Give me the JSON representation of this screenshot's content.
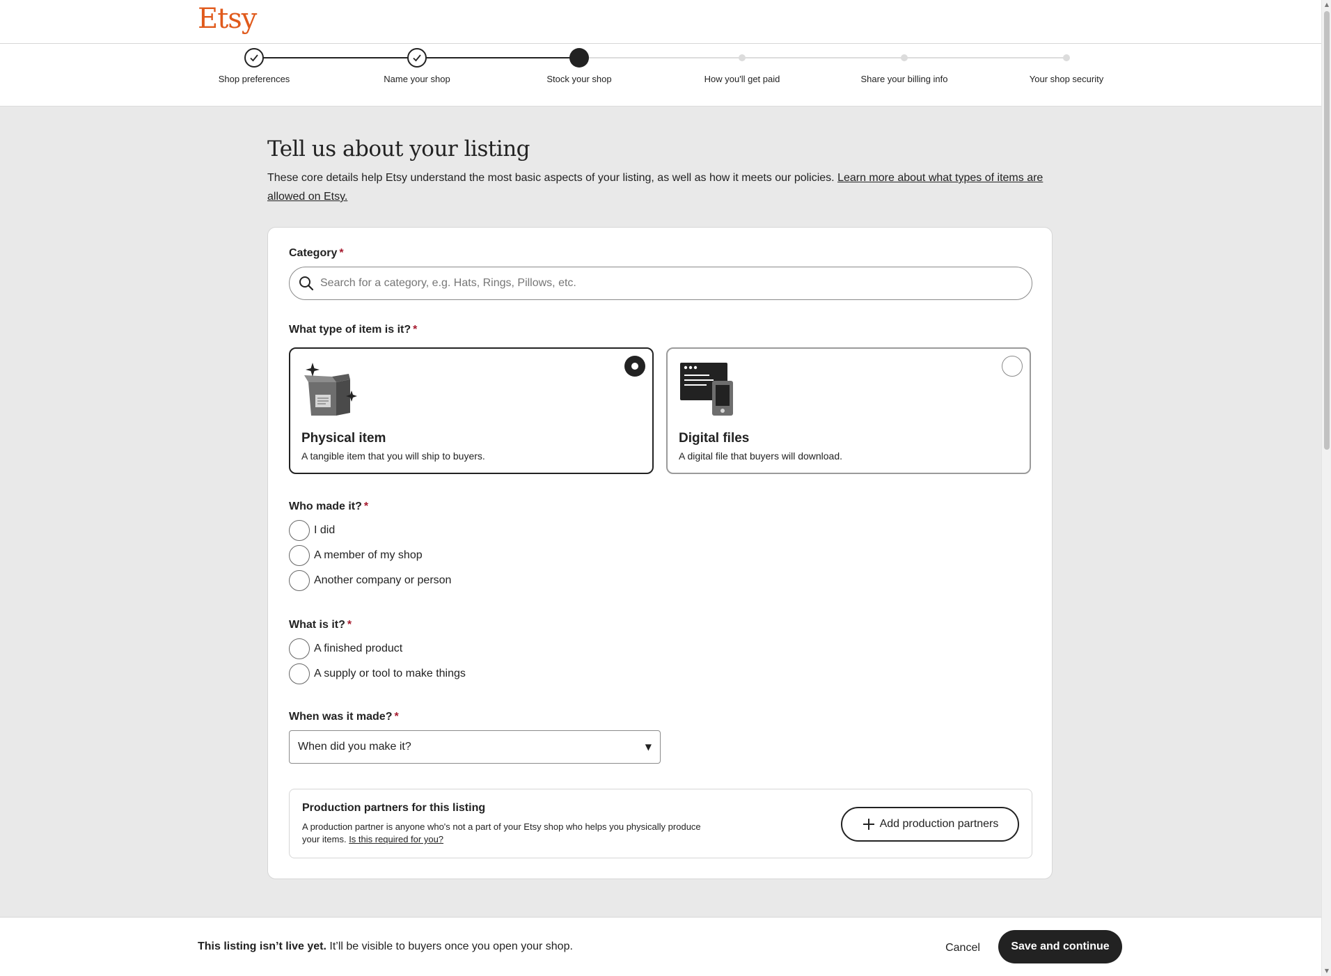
{
  "header": {
    "logo": "Etsy"
  },
  "stepper": {
    "steps": [
      {
        "label": "Shop preferences",
        "state": "done"
      },
      {
        "label": "Name your shop",
        "state": "done"
      },
      {
        "label": "Stock your shop",
        "state": "current"
      },
      {
        "label": "How you'll get paid",
        "state": "future"
      },
      {
        "label": "Share your billing info",
        "state": "future"
      },
      {
        "label": "Your shop security",
        "state": "future"
      }
    ]
  },
  "main": {
    "title": "Tell us about your listing",
    "description": "These core details help Etsy understand the most basic aspects of your listing, as well as how it meets our policies. ",
    "learn_more_link": "Learn more about what types of items are allowed on Etsy."
  },
  "form": {
    "required_marker": "*",
    "category": {
      "label": "Category",
      "placeholder": "Search for a category, e.g. Hats, Rings, Pillows, etc.",
      "value": ""
    },
    "item_type": {
      "label": "What type of item is it?",
      "options": [
        {
          "title": "Physical item",
          "description": "A tangible item that you will ship to buyers.",
          "selected": true,
          "icon": "package-icon"
        },
        {
          "title": "Digital files",
          "description": "A digital file that buyers will download.",
          "selected": false,
          "icon": "digital-files-icon"
        }
      ]
    },
    "who_made": {
      "label": "Who made it?",
      "options": [
        "I did",
        "A member of my shop",
        "Another company or person"
      ]
    },
    "what_is_it": {
      "label": "What is it?",
      "options": [
        "A finished product",
        "A supply or tool to make things"
      ]
    },
    "when_made": {
      "label": "When was it made?",
      "selected": "When did you make it?"
    },
    "production_partners": {
      "title": "Production partners for this listing",
      "description": "A production partner is anyone who's not a part of your Etsy shop who helps you physically produce your items. ",
      "link": "Is this required for you?",
      "button_label": "Add production partners"
    }
  },
  "footer": {
    "status_bold": "This listing isn’t live yet.",
    "status_rest": " It’ll be visible to buyers once you open your shop.",
    "cancel_label": "Cancel",
    "save_label": "Save and continue"
  },
  "colors": {
    "brand": "#e05a1c",
    "ink": "#222222",
    "required": "#a61a2e",
    "page_bg": "#e9e9e9"
  }
}
